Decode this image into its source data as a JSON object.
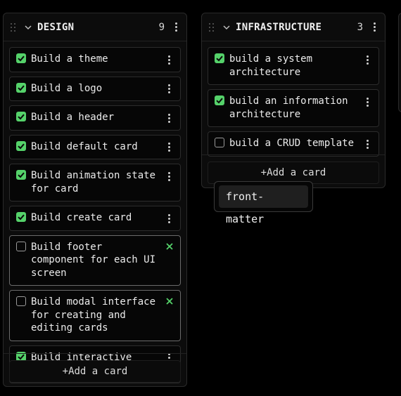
{
  "columns": [
    {
      "title": "DESIGN",
      "count": "9",
      "cards": [
        {
          "label": "Build a theme",
          "done": true
        },
        {
          "label": "Build a logo",
          "done": true
        },
        {
          "label": "Build a header",
          "done": true
        },
        {
          "label": "Build default card",
          "done": true
        },
        {
          "label": "Build animation state for card",
          "done": true
        },
        {
          "label": "Build create card",
          "done": true
        },
        {
          "label": "Build footer component for each UI screen",
          "done": false
        },
        {
          "label": "Build modal interface for creating and editing cards",
          "done": false
        },
        {
          "label": "Build interactive home page",
          "done": true
        }
      ],
      "add_label": "+Add a card"
    },
    {
      "title": "INFRASTRUCTURE",
      "count": "3",
      "cards": [
        {
          "label": "build a system architecture",
          "done": true
        },
        {
          "label": "build an information architecture",
          "done": true
        },
        {
          "label": "build a CRUD template",
          "done": false
        }
      ],
      "add_label": "+Add a card"
    }
  ],
  "tooltip": {
    "text": "front-matter"
  },
  "colors": {
    "check": "#55d26a",
    "x_icon": "#55d26a"
  }
}
